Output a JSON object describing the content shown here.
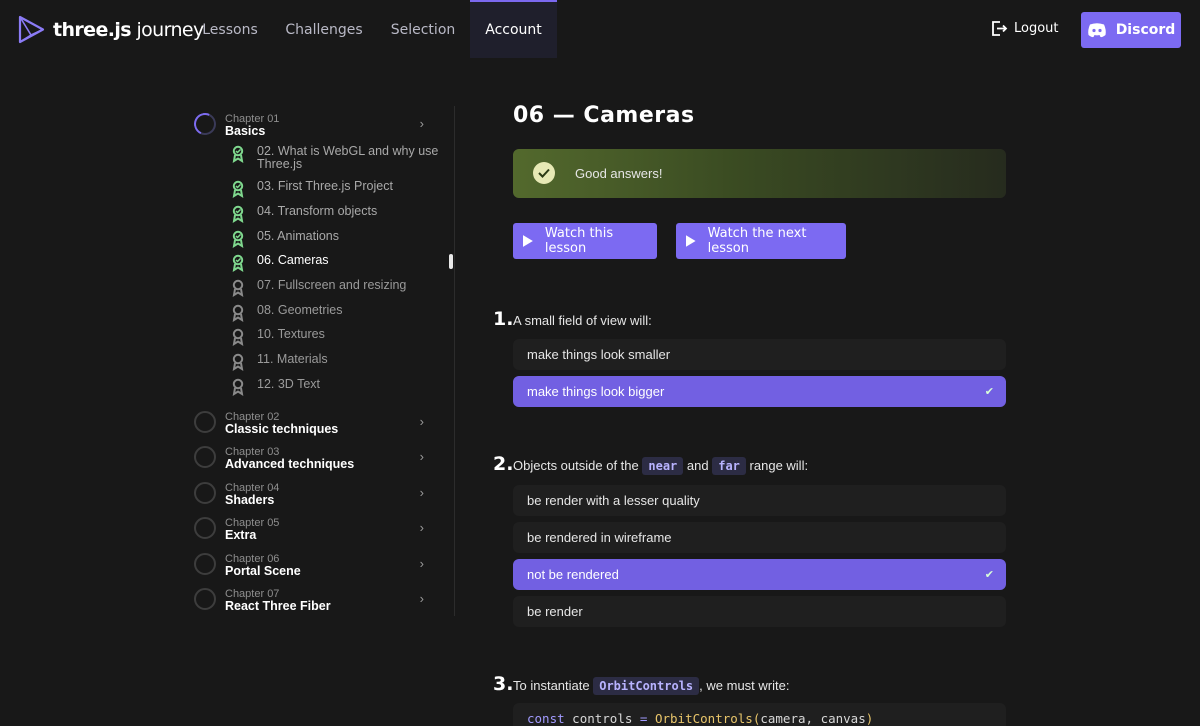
{
  "brand": {
    "bold": "three.js",
    "rest": "journey"
  },
  "nav": {
    "items": [
      "Lessons",
      "Challenges",
      "Selection",
      "Account"
    ],
    "active": "Account"
  },
  "header": {
    "logout_label": "Logout",
    "discord_label": "Discord"
  },
  "colors": {
    "accent": "#7c6af2",
    "background": "#181818",
    "success": "#53692d"
  },
  "sidebar": {
    "chapters": [
      {
        "num": "Chapter 01",
        "title": "Basics"
      },
      {
        "num": "Chapter 02",
        "title": "Classic techniques"
      },
      {
        "num": "Chapter 03",
        "title": "Advanced techniques"
      },
      {
        "num": "Chapter 04",
        "title": "Shaders"
      },
      {
        "num": "Chapter 05",
        "title": "Extra"
      },
      {
        "num": "Chapter 06",
        "title": "Portal Scene"
      },
      {
        "num": "Chapter 07",
        "title": "React Three Fiber"
      }
    ],
    "lessons": [
      {
        "label": "02. What is WebGL and why use Three.js",
        "status": "done"
      },
      {
        "label": "03. First Three.js Project",
        "status": "done"
      },
      {
        "label": "04. Transform objects",
        "status": "done"
      },
      {
        "label": "05. Animations",
        "status": "done"
      },
      {
        "label": "06. Cameras",
        "status": "current"
      },
      {
        "label": "07. Fullscreen and resizing",
        "status": "todo"
      },
      {
        "label": "08. Geometries",
        "status": "todo"
      },
      {
        "label": "10. Textures",
        "status": "todo"
      },
      {
        "label": "11. Materials",
        "status": "todo"
      },
      {
        "label": "12. 3D Text",
        "status": "todo"
      }
    ]
  },
  "main": {
    "title": "06 — Cameras",
    "success_message": "Good answers!",
    "watch_lesson": "Watch this lesson",
    "watch_next": "Watch the next lesson",
    "questions": [
      {
        "number": "1.",
        "text": "A small field of view will:",
        "answers": [
          "make things look smaller",
          "make things look bigger"
        ],
        "selected": 1
      },
      {
        "number": "2.",
        "text_before": "Objects outside of the",
        "code1": "near",
        "text_mid": "and",
        "code2": "far",
        "text_after": "range will:",
        "answers": [
          "be render with a lesser quality",
          "be rendered in wireframe",
          "not be rendered",
          "be render"
        ],
        "selected": 2
      },
      {
        "number": "3.",
        "text_before": "To instantiate",
        "code1": "OrbitControls",
        "text_after": ", we must write:",
        "code_line": {
          "kw": "const",
          "var": "controls",
          "eq": "=",
          "fn": "OrbitControls",
          "args": "camera, canvas"
        }
      }
    ]
  }
}
